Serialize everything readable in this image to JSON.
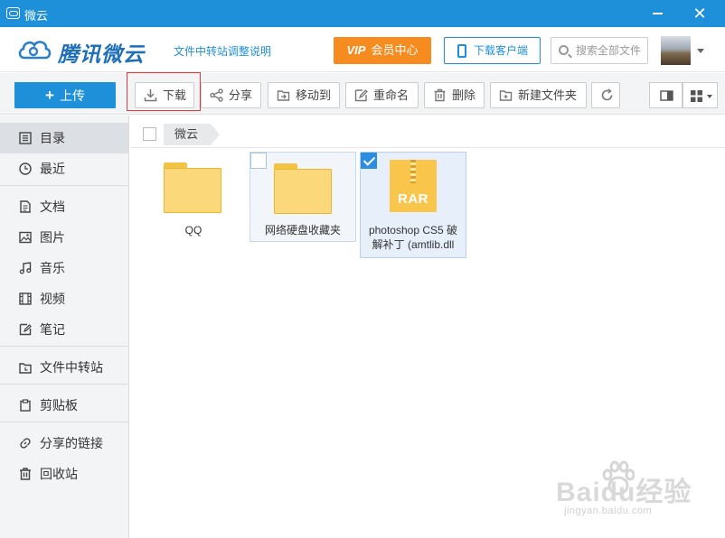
{
  "window": {
    "title": "微云"
  },
  "header": {
    "logo_text": "腾讯微云",
    "notice_link": "文件中转站调整说明",
    "vip_mark": "VIP",
    "vip_label": "会员中心",
    "download_client_label": "下载客户端",
    "search_placeholder": "搜索全部文件"
  },
  "toolbar": {
    "upload_label": "上传",
    "buttons": [
      {
        "label": "下载",
        "icon": "download-icon"
      },
      {
        "label": "分享",
        "icon": "share-icon"
      },
      {
        "label": "移动到",
        "icon": "move-icon"
      },
      {
        "label": "重命名",
        "icon": "rename-icon"
      },
      {
        "label": "删除",
        "icon": "trash-icon"
      },
      {
        "label": "新建文件夹",
        "icon": "new-folder-icon"
      }
    ]
  },
  "sidebar": {
    "items": [
      {
        "label": "目录",
        "icon": "catalog-icon",
        "active": true
      },
      {
        "label": "最近",
        "icon": "clock-icon"
      },
      {
        "label": "文档",
        "icon": "document-icon"
      },
      {
        "label": "图片",
        "icon": "image-icon"
      },
      {
        "label": "音乐",
        "icon": "music-icon"
      },
      {
        "label": "视频",
        "icon": "video-icon"
      },
      {
        "label": "笔记",
        "icon": "note-icon"
      },
      {
        "label": "文件中转站",
        "icon": "transfer-icon"
      },
      {
        "label": "剪贴板",
        "icon": "clipboard-icon"
      },
      {
        "label": "分享的链接",
        "icon": "link-icon"
      },
      {
        "label": "回收站",
        "icon": "recycle-bin-icon"
      }
    ]
  },
  "breadcrumb": {
    "current": "微云"
  },
  "files": [
    {
      "name": "QQ",
      "type": "folder",
      "selected": false
    },
    {
      "name": "网络硬盘收藏夹",
      "type": "folder",
      "selected": false
    },
    {
      "name_line1": "photoshop CS5 破",
      "name_line2": "解补丁 (amtlib.dll",
      "type": "rar",
      "badge": "RAR",
      "selected": true
    }
  ],
  "watermark": {
    "text": "Baidu经验",
    "sub": "jingyan.baidu.com"
  }
}
